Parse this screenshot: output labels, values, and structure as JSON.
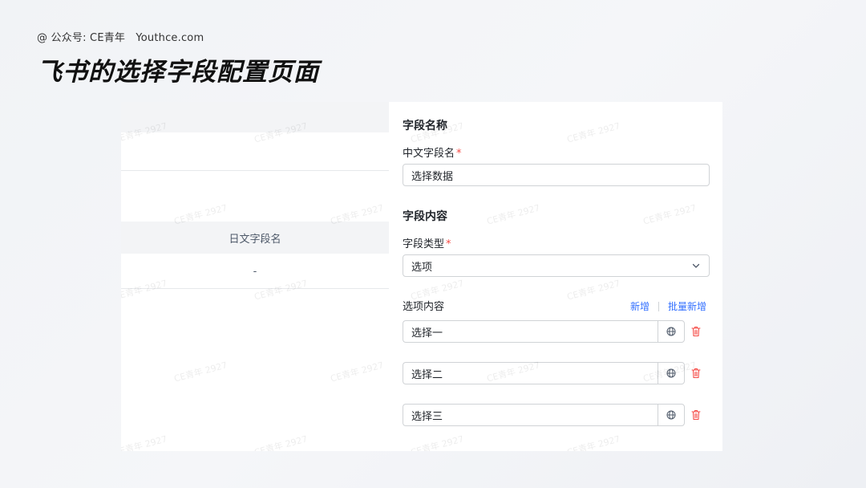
{
  "header": {
    "credit": "@ 公众号: CE青年　Youthce.com",
    "title": "飞书的选择字段配置页面"
  },
  "left_table": {
    "column_header": "日文字段名",
    "cell_value": "-"
  },
  "form": {
    "field_name_section": "字段名称",
    "chinese_name_label": "中文字段名",
    "required_mark": "*",
    "chinese_name_value": "选择数据",
    "field_content_section": "字段内容",
    "field_type_label": "字段类型",
    "field_type_value": "选项",
    "options_label": "选项内容",
    "add_label": "新增",
    "batch_add_label": "批量新增",
    "options": [
      "选择一",
      "选择二",
      "选择三"
    ]
  },
  "watermark": "CE青年 2927",
  "colors": {
    "accent": "#3370ff",
    "required": "#f54a45",
    "delete": "#f54a45"
  }
}
